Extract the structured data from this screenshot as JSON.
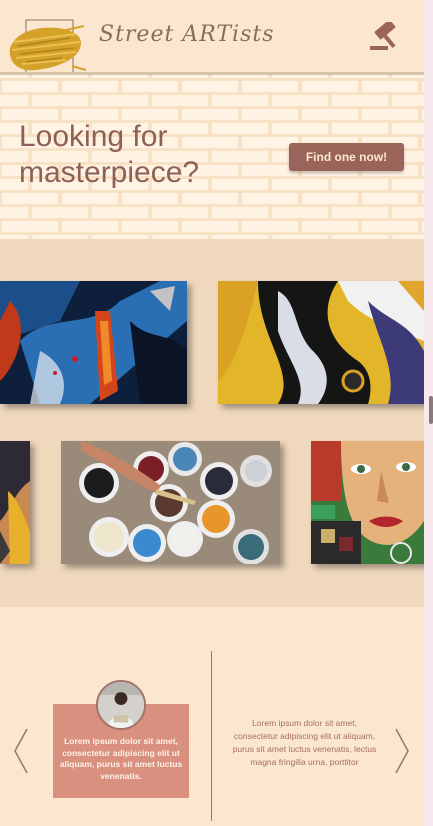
{
  "header": {
    "brand": "Street ARTists",
    "logo_icon": "gold-paint-swatch-logo",
    "auction_icon": "gavel-icon"
  },
  "hero": {
    "title": "Looking for masterpiece?",
    "cta_label": "Find one now!"
  },
  "gallery": {
    "row1": [
      "abstract-blue-red-painting",
      "fluid-art-yellow-black"
    ],
    "row2": [
      "fluid-art-partial",
      "paint-cans-brush",
      "graffiti-face-mural"
    ]
  },
  "testimonials": {
    "card_text": "Lorem ipsum dolor sit amet, consectetur adipiscing elit ut aliquam, purus sit amet luctus venenatis.",
    "second_text": "Lorem ipsum dolor sit amet, consectetur adipiscing elit ut aliquam, purus sit amet luctus venenatis, lectus magna fringilla urna, porttitor",
    "prev_icon": "chevron-left-icon",
    "next_icon": "chevron-right-icon"
  },
  "colors": {
    "background": "#fbe7d0",
    "accent": "#9a645a",
    "title": "#8e5f55",
    "card": "#d9907e",
    "gallery_bg": "#f0d8bd"
  }
}
